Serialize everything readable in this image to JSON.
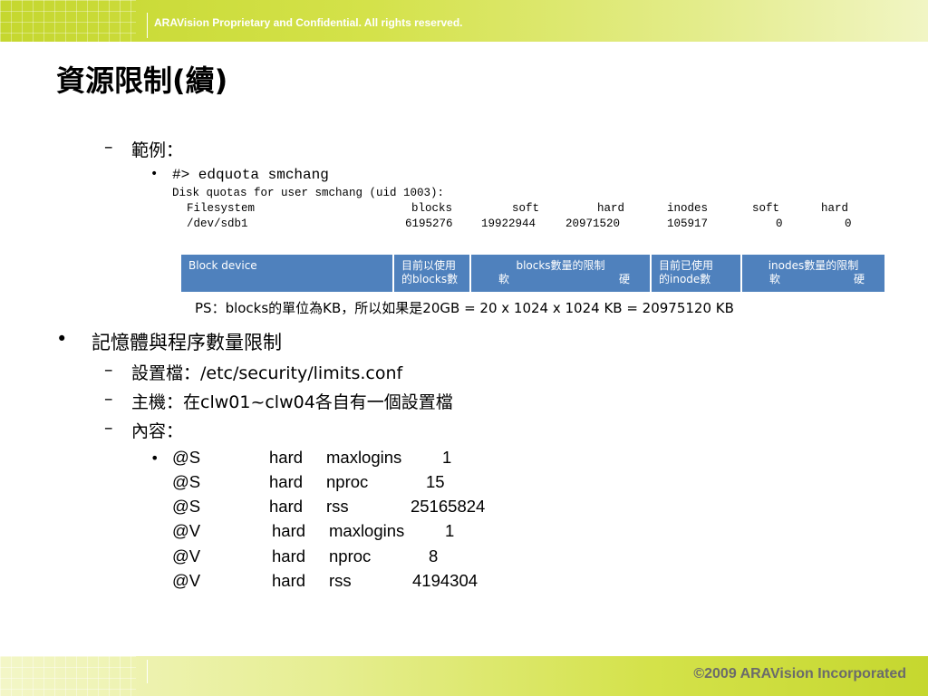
{
  "header": {
    "confidential": "ARAVision Proprietary and Confidential. All rights reserved."
  },
  "title": "資源限制(續)",
  "example": {
    "label": "範例：",
    "command": "#> edquota smchang",
    "line1": "Disk quotas for user smchang (uid 1003):",
    "columns": [
      "Filesystem",
      "blocks",
      "soft",
      "hard",
      "inodes",
      "soft",
      "hard"
    ],
    "values": [
      "/dev/sdb1",
      "6195276",
      "19922944",
      "20971520",
      "105917",
      "0",
      "0"
    ]
  },
  "table": {
    "block_device": "Block device",
    "used_blocks_l1": "目前以使用",
    "used_blocks_l2": "的blocks數",
    "blocks_limit_l1": "blocks數量的限制",
    "soft": "軟",
    "hard": "硬",
    "used_inodes_l1": "目前已使用",
    "used_inodes_l2": "的inode數",
    "inodes_limit_l1": "inodes數量的限制"
  },
  "ps_note": "PS：blocks的單位為KB，所以如果是20GB = 20 x 1024 x 1024 KB = 20975120 KB",
  "memory": {
    "heading": "記憶體與程序數量限制",
    "config_file": "設置檔：/etc/security/limits.conf",
    "hosts": "主機：在clw01~clw04各自有一個設置檔",
    "content_label": "內容：",
    "rows": [
      {
        "domain": "@S",
        "type": "hard",
        "item": "maxlogins",
        "value": "1"
      },
      {
        "domain": "@S",
        "type": "hard",
        "item": "nproc",
        "value": "15"
      },
      {
        "domain": "@S",
        "type": "hard",
        "item": "rss",
        "value": "25165824"
      },
      {
        "domain": "@V",
        "type": "hard",
        "item": "maxlogins",
        "value": "1"
      },
      {
        "domain": "@V",
        "type": "hard",
        "item": "nproc",
        "value": "8"
      },
      {
        "domain": "@V",
        "type": "hard",
        "item": "rss",
        "value": "4194304"
      }
    ]
  },
  "footer": {
    "copyright": "©2009 ARAVision Incorporated"
  }
}
